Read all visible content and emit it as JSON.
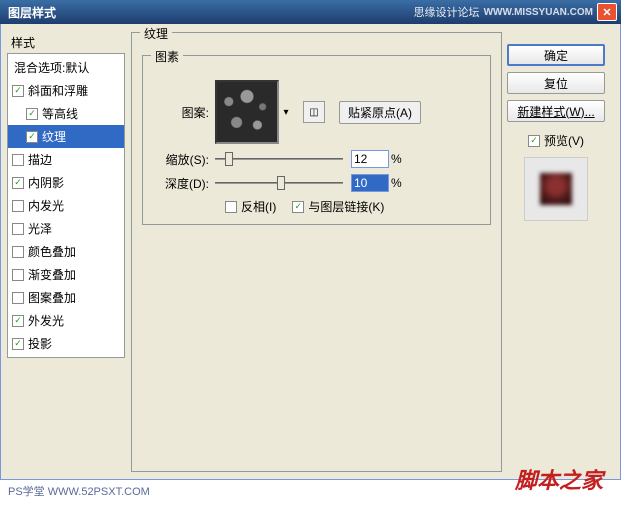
{
  "title": "图层样式",
  "titlebar_right": "思缘设计论坛",
  "titlebar_url": "WWW.MISSYUAN.COM",
  "sidebar": {
    "header": "样式",
    "items": [
      {
        "label": "混合选项:默认",
        "checked": null,
        "indent": false,
        "selected": false
      },
      {
        "label": "斜面和浮雕",
        "checked": true,
        "indent": false,
        "selected": false
      },
      {
        "label": "等高线",
        "checked": true,
        "indent": true,
        "selected": false
      },
      {
        "label": "纹理",
        "checked": true,
        "indent": true,
        "selected": true
      },
      {
        "label": "描边",
        "checked": false,
        "indent": false,
        "selected": false
      },
      {
        "label": "内阴影",
        "checked": true,
        "indent": false,
        "selected": false
      },
      {
        "label": "内发光",
        "checked": false,
        "indent": false,
        "selected": false
      },
      {
        "label": "光泽",
        "checked": false,
        "indent": false,
        "selected": false
      },
      {
        "label": "颜色叠加",
        "checked": false,
        "indent": false,
        "selected": false
      },
      {
        "label": "渐变叠加",
        "checked": false,
        "indent": false,
        "selected": false
      },
      {
        "label": "图案叠加",
        "checked": false,
        "indent": false,
        "selected": false
      },
      {
        "label": "外发光",
        "checked": true,
        "indent": false,
        "selected": false
      },
      {
        "label": "投影",
        "checked": true,
        "indent": false,
        "selected": false
      }
    ]
  },
  "main": {
    "outer_group": "纹理",
    "inner_group": "图素",
    "pattern_label": "图案:",
    "snap_origin": "贴紧原点(A)",
    "scale_label": "缩放(S):",
    "scale_value": "12",
    "depth_label": "深度(D):",
    "depth_value": "10",
    "percent": "%",
    "invert": "反相(I)",
    "link_layer": "与图层链接(K)"
  },
  "right": {
    "ok": "确定",
    "cancel": "复位",
    "new_style": "新建样式(W)...",
    "preview": "预览(V)"
  },
  "watermark1": "PS学堂  WWW.52PSXT.COM",
  "watermark2": "脚本之家"
}
